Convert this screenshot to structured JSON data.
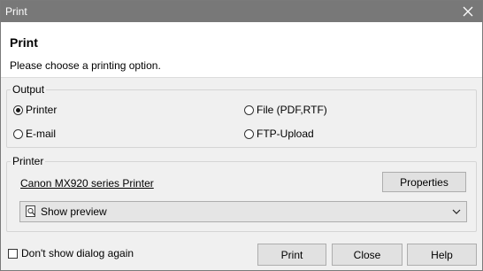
{
  "window": {
    "title": "Print"
  },
  "header": {
    "title": "Print",
    "subtitle": "Please choose a printing option."
  },
  "output": {
    "legend": "Output",
    "options": [
      {
        "label": "Printer",
        "selected": true
      },
      {
        "label": "File (PDF,RTF)",
        "selected": false
      },
      {
        "label": "E-mail",
        "selected": false
      },
      {
        "label": "FTP-Upload",
        "selected": false
      }
    ]
  },
  "printer": {
    "legend": "Printer",
    "name": "Canon MX920 series Printer",
    "properties_label": "Properties",
    "preview_select": {
      "value": "Show preview",
      "icon": "magnifier-page-icon"
    }
  },
  "footer": {
    "dont_show_label": "Don't show dialog again",
    "dont_show_checked": false,
    "print_label": "Print",
    "close_label": "Close",
    "help_label": "Help"
  }
}
